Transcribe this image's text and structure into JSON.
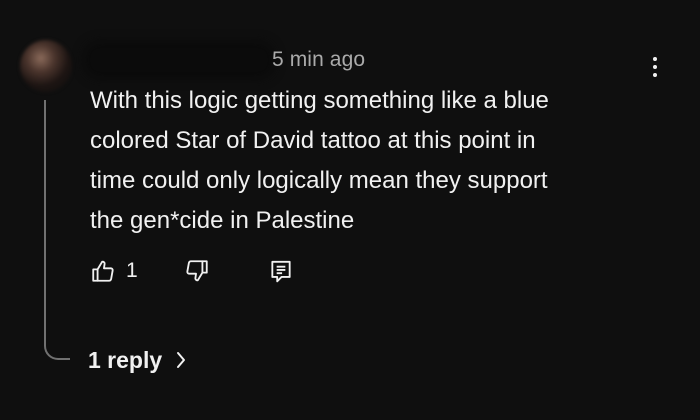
{
  "comment": {
    "timestamp": "5 min ago",
    "text_lines": [
      "With this logic getting something like a blue",
      "colored Star of David tattoo at this point in",
      "time could only logically mean they support",
      "the gen*cide in Palestine"
    ],
    "like_count": "1",
    "replies_label": "1 reply"
  },
  "icons": {
    "menu": "more-vert-icon",
    "like": "thumb-up-icon",
    "dislike": "thumb-down-icon",
    "reply": "comment-icon",
    "expand": "chevron-right-icon"
  },
  "colors": {
    "background": "#0f0f0f",
    "text_primary": "#f1f1f1",
    "text_secondary": "#aaaaaa",
    "thread_line": "#717171"
  }
}
